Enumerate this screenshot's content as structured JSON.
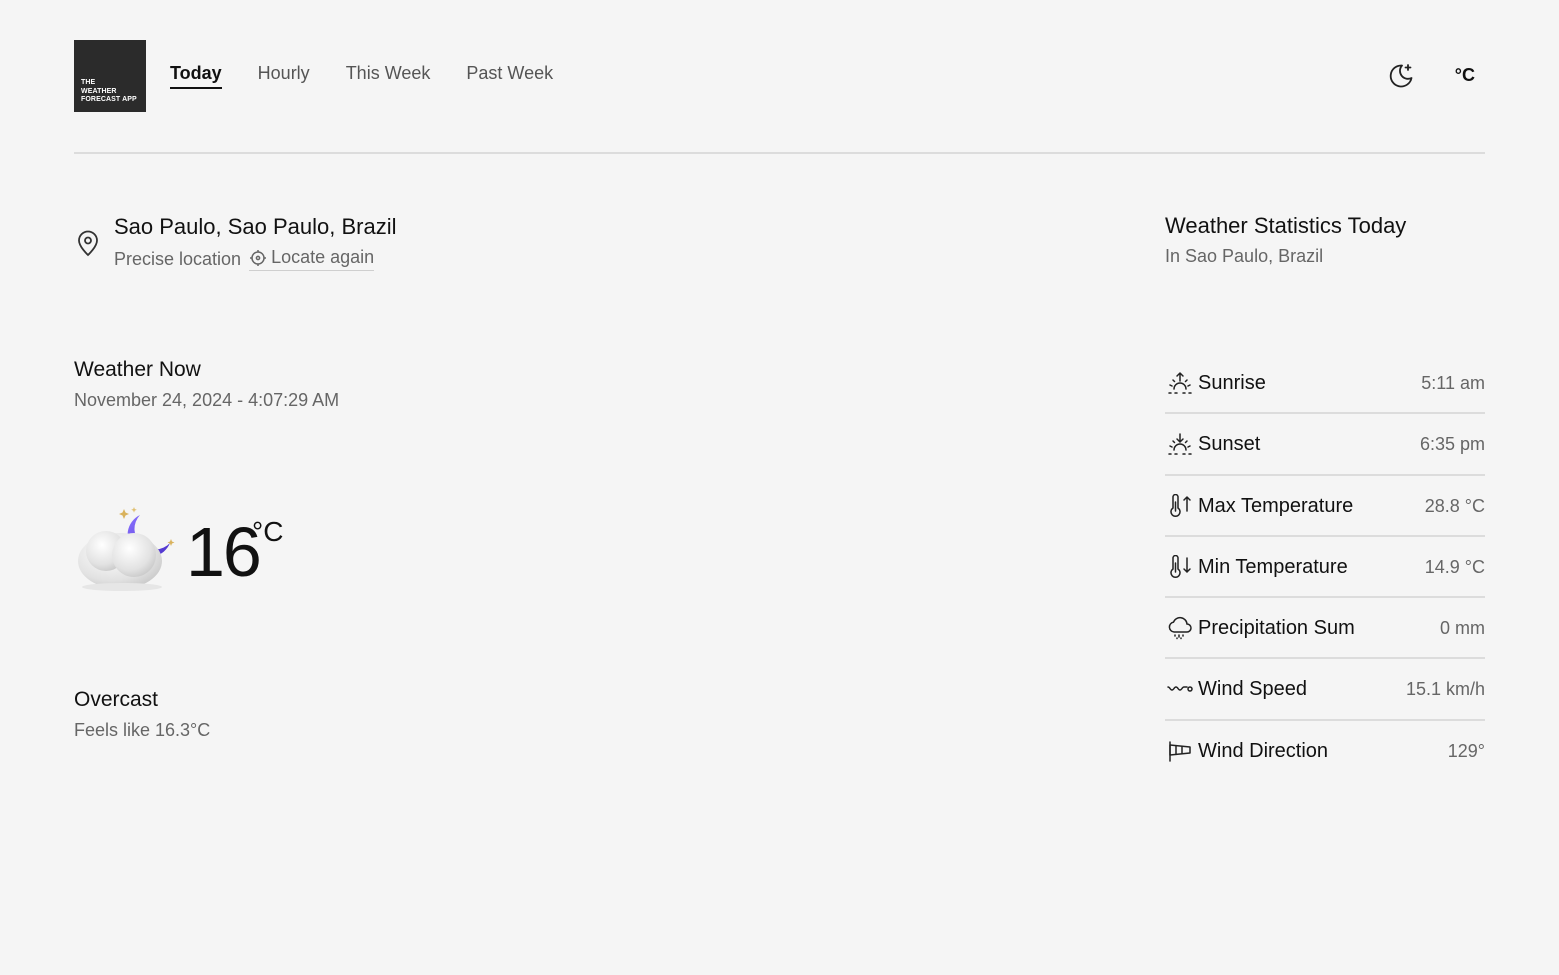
{
  "header": {
    "logo_lines": [
      "THE",
      "WEATHER",
      "FORECAST APP"
    ],
    "nav": [
      {
        "label": "Today",
        "active": true
      },
      {
        "label": "Hourly",
        "active": false
      },
      {
        "label": "This Week",
        "active": false
      },
      {
        "label": "Past Week",
        "active": false
      }
    ],
    "theme_icon": "moon-icon",
    "unit_toggle": "°C"
  },
  "location": {
    "name": "Sao Paulo, Sao Paulo, Brazil",
    "precision": "Precise location",
    "locate_again": "Locate again",
    "icon": "map-pin-icon"
  },
  "weather_now": {
    "title": "Weather Now",
    "datetime": "November 24, 2024 - 4:07:29 AM",
    "temperature": "16",
    "unit": "°C",
    "icon": "cloud-moon-icon",
    "condition": "Overcast",
    "feels_like": "Feels like 16.3°C"
  },
  "stats": {
    "title": "Weather Statistics Today",
    "subtitle": "In Sao Paulo, Brazil",
    "items": [
      {
        "icon": "sunrise-icon",
        "label": "Sunrise",
        "value": "5:11 am"
      },
      {
        "icon": "sunset-icon",
        "label": "Sunset",
        "value": "6:35 pm"
      },
      {
        "icon": "thermometer-up-icon",
        "label": "Max Temperature",
        "value": "28.8 °C"
      },
      {
        "icon": "thermometer-down-icon",
        "label": "Min Temperature",
        "value": "14.9 °C"
      },
      {
        "icon": "cloud-rain-icon",
        "label": "Precipitation Sum",
        "value": "0 mm"
      },
      {
        "icon": "wind-icon",
        "label": "Wind Speed",
        "value": "15.1 km/h"
      },
      {
        "icon": "windsock-icon",
        "label": "Wind Direction",
        "value": "129°"
      }
    ]
  },
  "colors": {
    "background": "#f5f5f5",
    "logo_bg": "#2b2b2b",
    "moon_purple": "#6b4fe0",
    "muted_text": "#666666"
  }
}
